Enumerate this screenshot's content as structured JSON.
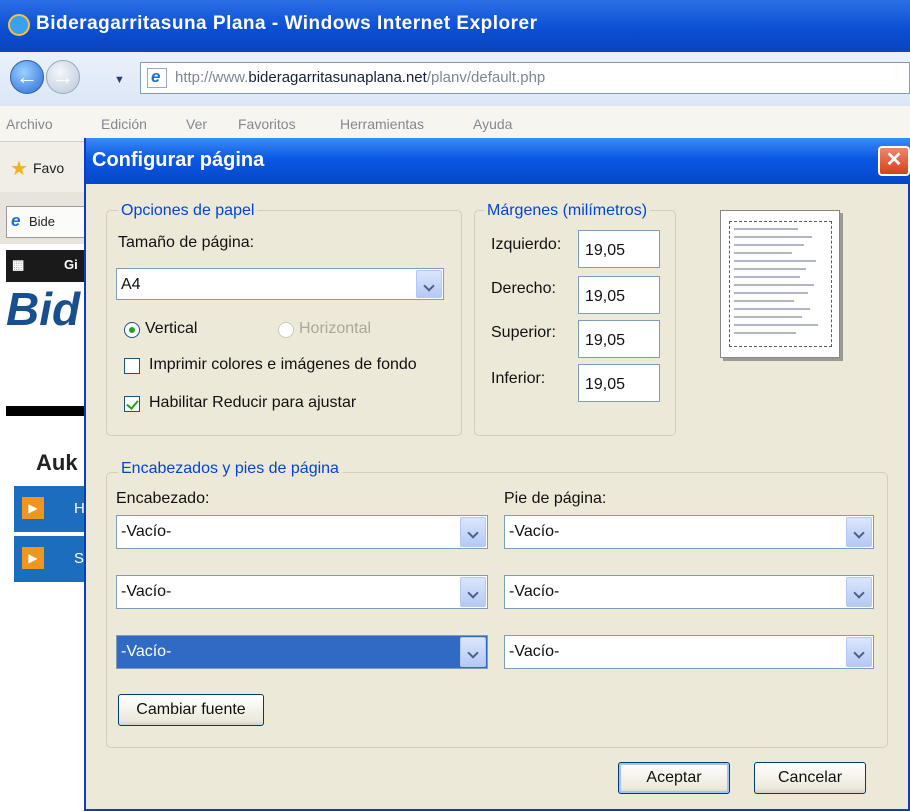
{
  "browser": {
    "title": "Bideragarritasuna Plana - Windows Internet Explorer",
    "url_prefix": "http://www.",
    "url_domain": "bideragarritasunaplana.net",
    "url_path": "/planv/default.php",
    "menu": [
      "Archivo",
      "Edición",
      "Ver",
      "Favoritos",
      "Herramientas",
      "Ayuda"
    ],
    "favorites_label": "Favo",
    "tab_label": "Bide",
    "page_logo": "Bid",
    "page_heading": "Auk",
    "black_bar_label": "Gi",
    "blue_bar_letters": [
      "H",
      "S"
    ]
  },
  "dialog": {
    "title": "Configurar página",
    "paper": {
      "legend": "Opciones de papel",
      "size_label": "Tamaño de página:",
      "size_value": "A4",
      "orientation_vertical": "Vertical",
      "orientation_horizontal": "Horizontal",
      "print_bg_label": "Imprimir colores e imágenes de fondo",
      "shrink_label": "Habilitar Reducir para ajustar",
      "print_bg_checked": false,
      "shrink_checked": true,
      "selected_orientation": "Vertical"
    },
    "margins": {
      "legend": "Márgenes (milímetros)",
      "left_label": "Izquierdo:",
      "left_value": "19,05",
      "right_label": "Derecho:",
      "right_value": "19,05",
      "top_label": "Superior:",
      "top_value": "19,05",
      "bottom_label": "Inferior:",
      "bottom_value": "19,05"
    },
    "headers": {
      "legend": "Encabezados y pies de página",
      "header_label": "Encabezado:",
      "footer_label": "Pie de página:",
      "header_values": [
        "-Vacío-",
        "-Vacío-",
        "-Vacío-"
      ],
      "footer_values": [
        "-Vacío-",
        "-Vacío-",
        "-Vacío-"
      ]
    },
    "change_font_button": "Cambiar fuente",
    "ok_button": "Aceptar",
    "cancel_button": "Cancelar"
  },
  "colors": {
    "title_blue": "#0a58e3",
    "legend_blue": "#0046d5",
    "dialog_bg": "#ece9d8",
    "selection_blue": "#316ac5"
  }
}
